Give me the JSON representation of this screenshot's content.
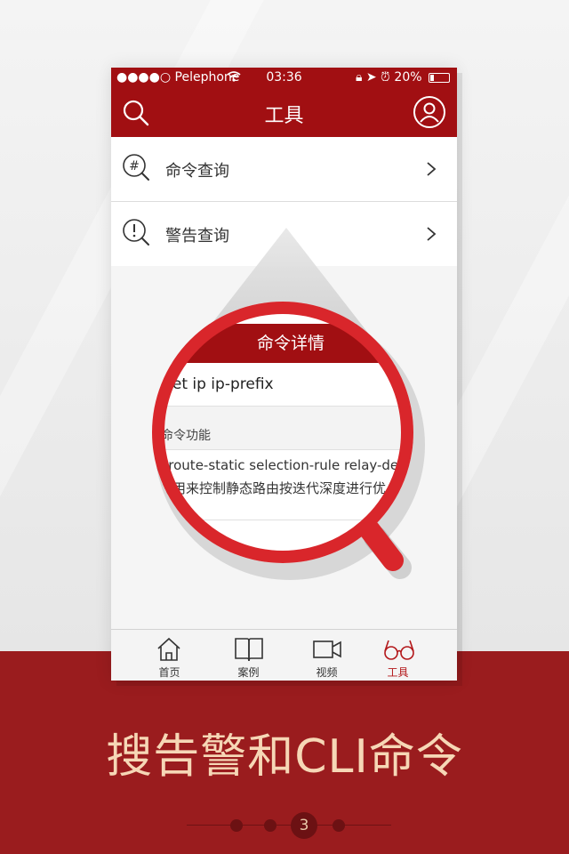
{
  "status_bar": {
    "carrier": "●●●●○ Pelephone",
    "time": "03:36",
    "battery": "20%"
  },
  "nav": {
    "title": "工具"
  },
  "menu": [
    {
      "label": "命令查询",
      "icon": "hash-search-icon"
    },
    {
      "label": "警告查询",
      "icon": "exclamation-search-icon"
    }
  ],
  "magnifier": {
    "header": "命令详情",
    "command": "set ip ip-prefix",
    "section_title": "命令功能",
    "desc_line1": "p route-static selection-rule relay-dep",
    "desc_line2": "令用来控制静态路由按迭代深度进行优"
  },
  "tabs": [
    {
      "label": "首页",
      "icon": "home-icon"
    },
    {
      "label": "案例",
      "icon": "book-icon"
    },
    {
      "label": "视频",
      "icon": "video-camera-icon"
    },
    {
      "label": "工具",
      "icon": "glasses-icon",
      "active": true
    }
  ],
  "promo": {
    "text": "搜告警和CLI命令"
  },
  "pager": {
    "current": "3"
  },
  "colors": {
    "brand_red": "#a10f12",
    "band_red": "#9a1c1e",
    "lens_red": "#d9262b",
    "promo_text": "#f6d7b6"
  }
}
